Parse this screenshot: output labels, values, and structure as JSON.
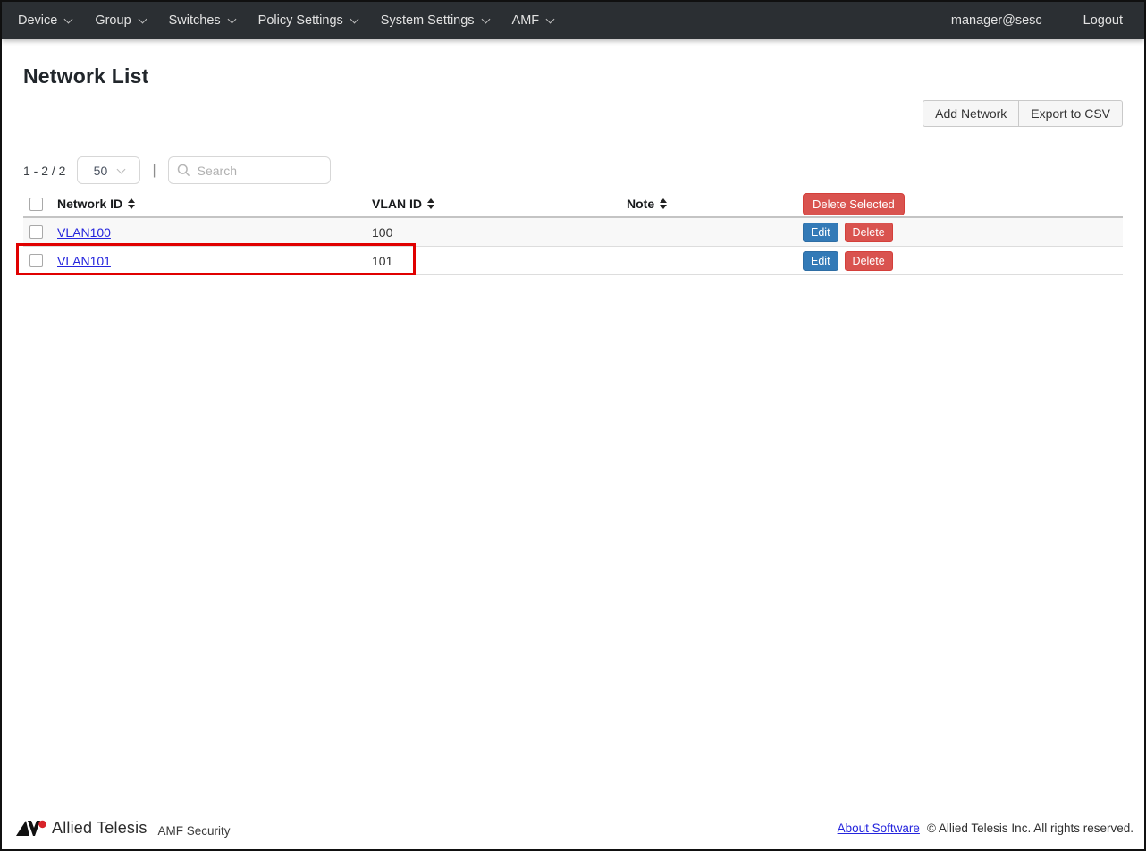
{
  "navbar": {
    "menus": [
      {
        "label": "Device"
      },
      {
        "label": "Group"
      },
      {
        "label": "Switches"
      },
      {
        "label": "Policy Settings"
      },
      {
        "label": "System Settings"
      },
      {
        "label": "AMF"
      }
    ],
    "user": "manager@sesc",
    "logout_label": "Logout"
  },
  "page": {
    "title": "Network List"
  },
  "toolbar": {
    "add_network_label": "Add Network",
    "export_csv_label": "Export to CSV"
  },
  "list_controls": {
    "range_text": "1 - 2 / 2",
    "page_size": "50",
    "divider": "|",
    "search_placeholder": "Search"
  },
  "table": {
    "columns": {
      "network_id": "Network ID",
      "vlan_id": "VLAN ID",
      "note": "Note"
    },
    "delete_selected_label": "Delete Selected",
    "rows": [
      {
        "network_id": "VLAN100",
        "vlan_id": "100",
        "note": "",
        "edit_label": "Edit",
        "delete_label": "Delete"
      },
      {
        "network_id": "VLAN101",
        "vlan_id": "101",
        "note": "",
        "edit_label": "Edit",
        "delete_label": "Delete",
        "highlighted": true
      }
    ]
  },
  "footer": {
    "brand": "Allied Telesis",
    "product": "AMF Security",
    "about_link": "About Software",
    "copyright": "© Allied Telesis Inc. All rights reserved."
  },
  "colors": {
    "navbar_bg": "#2b2f33",
    "danger": "#d9534f",
    "primary": "#337ab7",
    "link": "#2525dd",
    "annotation": "#e00000",
    "stripe": "#f8f8f8"
  }
}
